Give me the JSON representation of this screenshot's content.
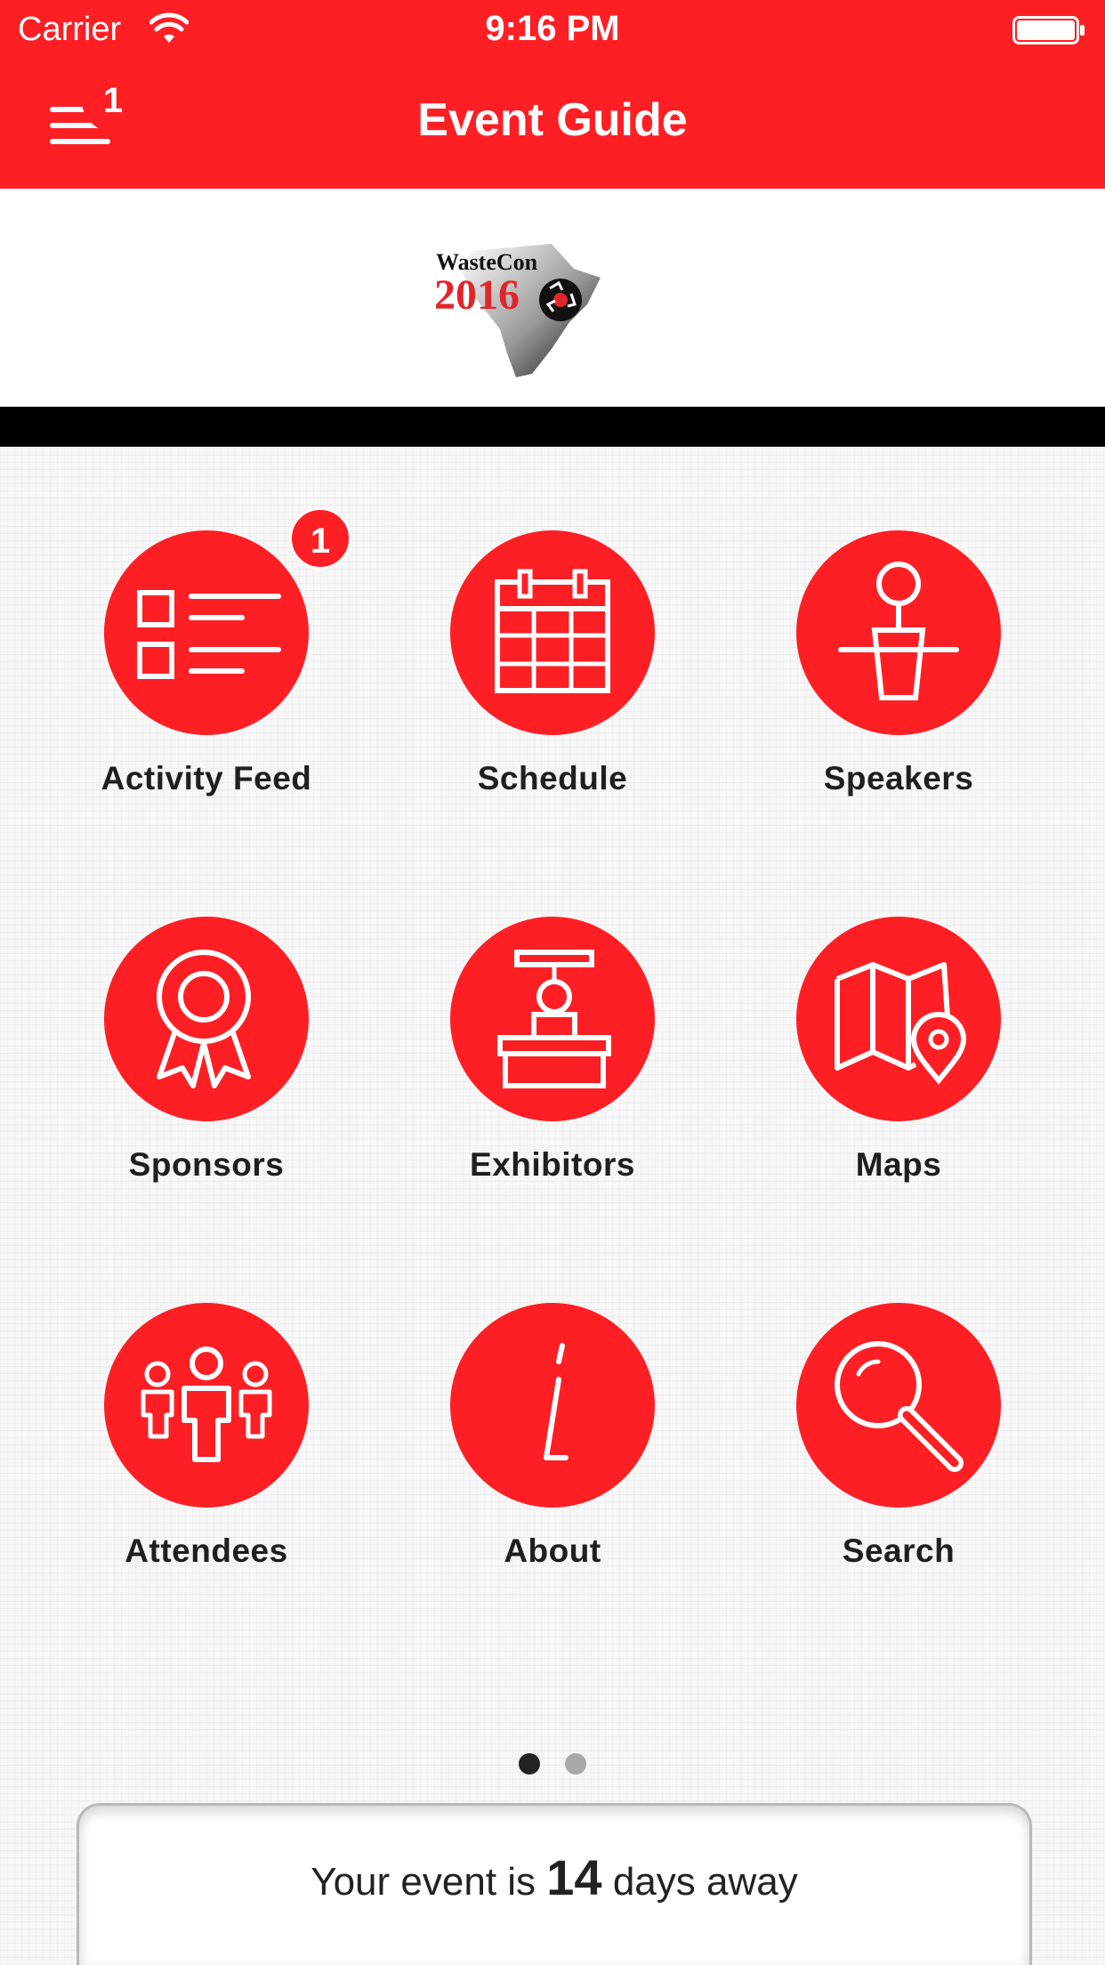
{
  "status_bar": {
    "carrier": "Carrier",
    "time": "9:16 PM",
    "wifi_icon": "wifi-icon",
    "battery_icon": "battery-icon"
  },
  "nav": {
    "title": "Event Guide",
    "menu_icon": "hamburger-menu-icon",
    "menu_badge": "1"
  },
  "logo": {
    "title": "WasteCon",
    "year": "2016"
  },
  "tiles": [
    {
      "label": "Activity Feed",
      "icon": "activity-feed-icon",
      "badge": "1"
    },
    {
      "label": "Schedule",
      "icon": "calendar-icon"
    },
    {
      "label": "Speakers",
      "icon": "speaker-podium-icon"
    },
    {
      "label": "Sponsors",
      "icon": "award-ribbon-icon"
    },
    {
      "label": "Exhibitors",
      "icon": "exhibitor-booth-icon"
    },
    {
      "label": "Maps",
      "icon": "map-pin-icon"
    },
    {
      "label": "Attendees",
      "icon": "people-group-icon"
    },
    {
      "label": "About",
      "icon": "info-icon"
    },
    {
      "label": "Search",
      "icon": "magnifier-icon"
    }
  ],
  "pager": {
    "pages": 2,
    "current": 1
  },
  "countdown": {
    "prefix": "Your event is",
    "days": "14",
    "suffix": "days away"
  },
  "colors": {
    "accent": "#fe1f24",
    "dot_active": "#222222",
    "dot_inactive": "#a8a8a8"
  }
}
